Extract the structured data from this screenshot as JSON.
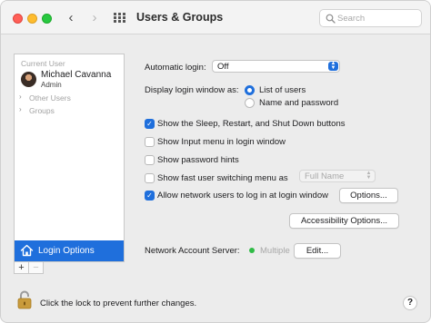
{
  "window": {
    "title": "Users & Groups",
    "nav_back": "‹",
    "nav_forward": "›"
  },
  "search": {
    "placeholder": "Search",
    "value": ""
  },
  "sidebar": {
    "current_user_header": "Current User",
    "current_user": {
      "name": "Michael Cavanna",
      "role": "Admin"
    },
    "groups": [
      {
        "label": "Other Users",
        "disclosure": "›"
      },
      {
        "label": "Groups",
        "disclosure": "›"
      }
    ],
    "login_options_label": "Login Options",
    "add_label": "+",
    "remove_label": "−"
  },
  "settings": {
    "automatic_login": {
      "label": "Automatic login:",
      "value": "Off"
    },
    "display_login_window": {
      "label": "Display login window as:",
      "options": [
        {
          "label": "List of users",
          "selected": true
        },
        {
          "label": "Name and password",
          "selected": false
        }
      ]
    },
    "checkboxes": [
      {
        "label": "Show the Sleep, Restart, and Shut Down buttons",
        "checked": true
      },
      {
        "label": "Show Input menu in login window",
        "checked": false
      },
      {
        "label": "Show password hints",
        "checked": false
      },
      {
        "label": "Show fast user switching menu as",
        "checked": false
      },
      {
        "label": "Allow network users to log in at login window",
        "checked": true
      }
    ],
    "fast_user_switching_value": "Full Name",
    "options_button": "Options...",
    "accessibility_button": "Accessibility Options...",
    "network_account_server": {
      "label": "Network Account Server:",
      "status": "Multiple",
      "status_color": "#2fbb46",
      "edit_button": "Edit..."
    }
  },
  "footer": {
    "lock_text": "Click the lock to prevent further changes.",
    "help_label": "?"
  },
  "colors": {
    "accent": "#1f6fdc"
  }
}
